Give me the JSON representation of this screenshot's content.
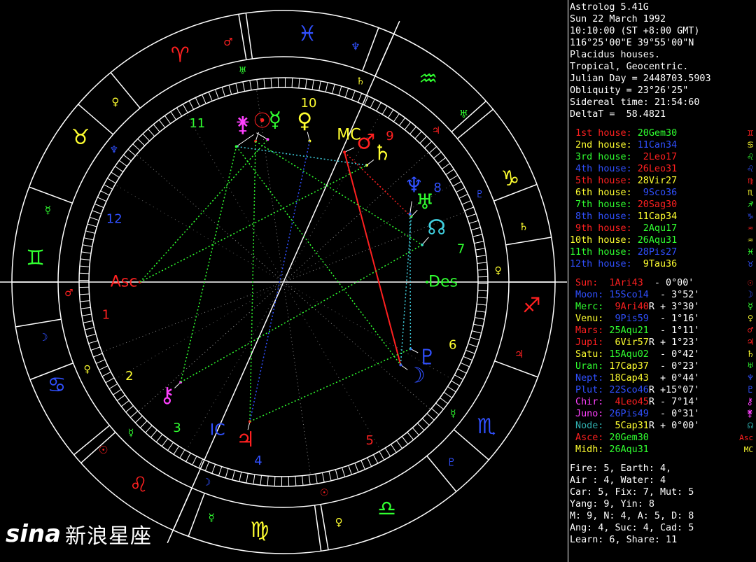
{
  "header_lines": [
    "Astrolog 5.41G",
    "Sun 22 March 1992",
    "10:10:00 (ST +8:00 GMT)",
    "116°25'00\"E 39°55'00\"N",
    "Placidus houses.",
    "Tropical, Geocentric.",
    "Julian Day = 2448703.5903",
    "Obliquity = 23°26'25\"",
    "Sidereal time: 21:54:60",
    "DeltaT =  58.4821"
  ],
  "houses": [
    {
      "name": "1st house:",
      "value": "20Gem30",
      "symbol": "♊",
      "color": "#ff2020",
      "value_color": "#30ff30"
    },
    {
      "name": "2nd house:",
      "value": "11Can34",
      "symbol": "♋",
      "color": "#ffff30",
      "value_color": "#3050ff"
    },
    {
      "name": "3rd house:",
      "value": "2Leo17",
      "symbol": "♌",
      "color": "#30ff30",
      "value_color": "#ff2020"
    },
    {
      "name": "4th house:",
      "value": "26Leo31",
      "symbol": "♌",
      "color": "#3050ff",
      "value_color": "#ff2020"
    },
    {
      "name": "5th house:",
      "value": "28Vir27",
      "symbol": "♍",
      "color": "#ff2020",
      "value_color": "#ffff30"
    },
    {
      "name": "6th house:",
      "value": "9Sco36",
      "symbol": "♏",
      "color": "#ffff30",
      "value_color": "#3050ff"
    },
    {
      "name": "7th house:",
      "value": "20Sag30",
      "symbol": "♐",
      "color": "#30ff30",
      "value_color": "#ff2020"
    },
    {
      "name": "8th house:",
      "value": "11Cap34",
      "symbol": "♑",
      "color": "#3050ff",
      "value_color": "#ffff30"
    },
    {
      "name": "9th house:",
      "value": "2Aqu17",
      "symbol": "♒",
      "color": "#ff2020",
      "value_color": "#30ff30"
    },
    {
      "name": "10th house:",
      "value": "26Aqu31",
      "symbol": "♒",
      "color": "#ffff30",
      "value_color": "#30ff30"
    },
    {
      "name": "11th house:",
      "value": "28Pis27",
      "symbol": "♓",
      "color": "#30ff30",
      "value_color": "#3050ff"
    },
    {
      "name": "12th house:",
      "value": "9Tau36",
      "symbol": "♉",
      "color": "#3050ff",
      "value_color": "#ffff30"
    }
  ],
  "planets": [
    {
      "name": "Sun:",
      "value": "1Ari43",
      "retro": "",
      "aspect": "- 0°00'",
      "symbol": "☉",
      "color": "#ff2020",
      "value_color": "#ff2020"
    },
    {
      "name": "Moon:",
      "value": "15Sco14",
      "retro": "",
      "aspect": "- 3°52'",
      "symbol": "☽",
      "color": "#3050ff",
      "value_color": "#3050ff"
    },
    {
      "name": "Merc:",
      "value": "9Ari40",
      "retro": "R",
      "aspect": "+ 3°30'",
      "symbol": "☿",
      "color": "#30ff30",
      "value_color": "#ff2020"
    },
    {
      "name": "Venu:",
      "value": "9Pis59",
      "retro": "",
      "aspect": "- 1°16'",
      "symbol": "♀",
      "color": "#ffff30",
      "value_color": "#3050ff"
    },
    {
      "name": "Mars:",
      "value": "25Aqu21",
      "retro": "",
      "aspect": "- 1°11'",
      "symbol": "♂",
      "color": "#ff2020",
      "value_color": "#30ff30"
    },
    {
      "name": "Jupi:",
      "value": "6Vir57",
      "retro": "R",
      "aspect": "+ 1°23'",
      "symbol": "♃",
      "color": "#ff2020",
      "value_color": "#ffff30"
    },
    {
      "name": "Satu:",
      "value": "15Aqu02",
      "retro": "",
      "aspect": "- 0°42'",
      "symbol": "♄",
      "color": "#ffff30",
      "value_color": "#30ff30"
    },
    {
      "name": "Uran:",
      "value": "17Cap37",
      "retro": "",
      "aspect": "- 0°23'",
      "symbol": "♅",
      "color": "#30ff30",
      "value_color": "#ffff30"
    },
    {
      "name": "Nept:",
      "value": "18Cap43",
      "retro": "",
      "aspect": "+ 0°44'",
      "symbol": "♆",
      "color": "#3050ff",
      "value_color": "#ffff30"
    },
    {
      "name": "Plut:",
      "value": "22Sco46",
      "retro": "R",
      "aspect": "+15°07'",
      "symbol": "♇",
      "color": "#3050ff",
      "value_color": "#3050ff"
    },
    {
      "name": "Chir:",
      "value": "4Leo45",
      "retro": "R",
      "aspect": "- 7°14'",
      "symbol": "⚷",
      "color": "#ff40ff",
      "value_color": "#ff2020"
    },
    {
      "name": "Juno:",
      "value": "26Pis49",
      "retro": "",
      "aspect": "- 0°31'",
      "symbol": "⚵",
      "color": "#ff40ff",
      "value_color": "#3050ff"
    },
    {
      "name": "Node:",
      "value": "5Cap31",
      "retro": "R",
      "aspect": "+ 0°00'",
      "symbol": "☊",
      "color": "#30b0b0",
      "value_color": "#ffff30"
    },
    {
      "name": "Asce:",
      "value": "20Gem30",
      "retro": "",
      "aspect": "",
      "symbol": "Asc",
      "color": "#ff2020",
      "value_color": "#30ff30"
    },
    {
      "name": "Midh:",
      "value": "26Aqu31",
      "retro": "",
      "aspect": "",
      "symbol": "MC",
      "color": "#ffff30",
      "value_color": "#30ff30"
    }
  ],
  "summary_lines": [
    "Fire: 5, Earth: 4,",
    "Air : 4, Water: 4",
    "Car: 5, Fix: 7, Mut: 5",
    "Yang: 9, Yin: 8",
    "M: 9, N: 4, A: 5, D: 8",
    "Ang: 4, Suc: 4, Cad: 5",
    "Learn: 6, Share: 11"
  ],
  "wheel": {
    "asc_label": "Asc",
    "des_label": "Des",
    "mc_label": "MC",
    "ic_label": "IC",
    "house_numbers": [
      "1",
      "2",
      "3",
      "4",
      "5",
      "6",
      "7",
      "8",
      "9",
      "10",
      "11",
      "12"
    ]
  },
  "watermark": {
    "logo_text": "sina",
    "cn_text": "新浪星座"
  },
  "colors": {
    "red": "#ff2020",
    "green": "#30ff30",
    "blue": "#3050ff",
    "yellow": "#ffff30",
    "magenta": "#ff40ff",
    "cyan": "#40d0e0",
    "white": "#ffffff"
  }
}
